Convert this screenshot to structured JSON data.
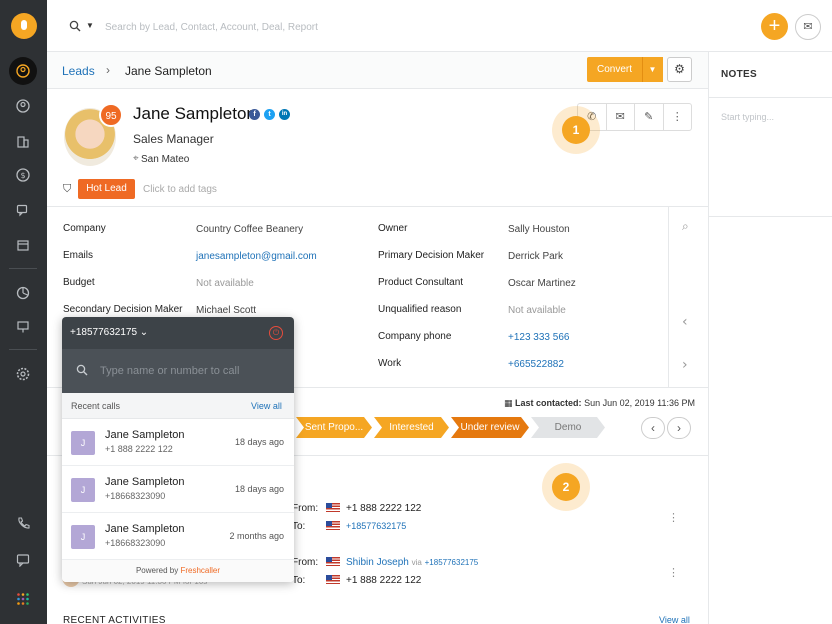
{
  "search": {
    "placeholder": "Search by Lead, Contact, Account, Deal, Report"
  },
  "breadcrumb": {
    "parent": "Leads",
    "current": "Jane Sampleton"
  },
  "header_actions": {
    "convert": "Convert"
  },
  "notes": {
    "title": "NOTES",
    "placeholder": "Start typing..."
  },
  "profile": {
    "name": "Jane Sampleton",
    "score": "95",
    "title": "Sales Manager",
    "location": "San Mateo",
    "tag": "Hot Lead",
    "add_tags": "Click to add tags",
    "social": [
      "f",
      "t",
      "in"
    ]
  },
  "details_left": [
    {
      "label": "Company",
      "value": "Country Coffee Beanery",
      "style": "plain"
    },
    {
      "label": "Emails",
      "value": "janesampleton@gmail.com",
      "style": "link"
    },
    {
      "label": "Budget",
      "value": "Not available",
      "style": "muted"
    },
    {
      "label": "Secondary Decision Maker",
      "value": "Michael Scott",
      "style": "plain"
    }
  ],
  "details_right": [
    {
      "label": "Owner",
      "value": "Sally Houston",
      "style": "plain"
    },
    {
      "label": "Primary Decision Maker",
      "value": "Derrick Park",
      "style": "plain"
    },
    {
      "label": "Product Consultant",
      "value": "Oscar Martinez",
      "style": "plain"
    },
    {
      "label": "Unqualified reason",
      "value": "Not available",
      "style": "muted"
    },
    {
      "label": "Company phone",
      "value": "+123 333 566",
      "style": "link"
    },
    {
      "label": "Work",
      "value": "+665522882",
      "style": "link"
    }
  ],
  "last_contacted": {
    "label": "Last contacted:",
    "value": "Sun Jun 02, 2019 11:36 PM"
  },
  "stages": [
    {
      "label": "Sent Propo...",
      "color": "#f5a623",
      "width": 76
    },
    {
      "label": "Interested",
      "color": "#f5a623",
      "width": 75
    },
    {
      "label": "Under review",
      "color": "#e5790f",
      "width": 78
    },
    {
      "label": "Demo",
      "color": "#e2e4e6",
      "width": 74
    }
  ],
  "calls": [
    {
      "from_label": "From:",
      "from": "+1 888 2222 122",
      "to_label": "To:",
      "to": "+18577632175"
    },
    {
      "from_label": "From:",
      "from": "Shibin Joseph",
      "via": "via",
      "via_num": "+18577632175",
      "to_label": "To:",
      "to": "+1 888 2222 122"
    }
  ],
  "faded_timestamp": "Sun Jun 02, 2019 11:36 PM for 10s",
  "recent_activities": {
    "title": "RECENT ACTIVITIES",
    "view_all": "View all"
  },
  "dialer": {
    "number": "+18577632175",
    "search_placeholder": "Type name or number to call",
    "recent_label": "Recent calls",
    "view_all": "View all",
    "items": [
      {
        "initial": "J",
        "name": "Jane Sampleton",
        "phone": "+1 888 2222 122",
        "time": "18 days ago"
      },
      {
        "initial": "J",
        "name": "Jane Sampleton",
        "phone": "+18668323090",
        "time": "18 days ago"
      },
      {
        "initial": "J",
        "name": "Jane Sampleton",
        "phone": "+18668323090",
        "time": "2 months ago"
      }
    ],
    "footer_prefix": "Powered by",
    "footer_brand": "Freshcaller"
  },
  "hotspots": [
    "1",
    "2"
  ],
  "colors": {
    "accent": "#f5a623",
    "hot": "#ef6a24",
    "link": "#1f72b8",
    "sidebar": "#2e3134"
  }
}
